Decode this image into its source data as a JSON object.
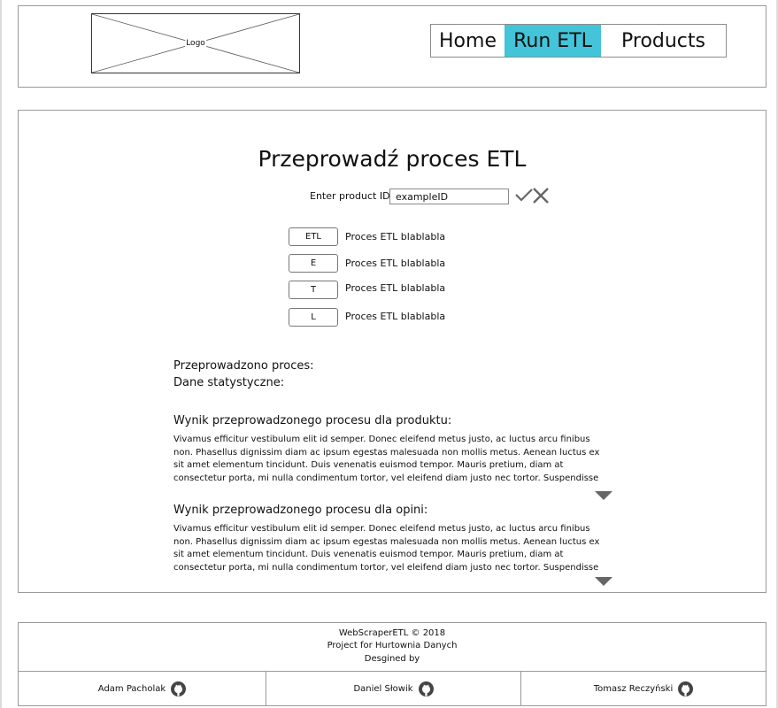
{
  "header": {
    "logo_text": "Logo",
    "nav": {
      "home": "Home",
      "run_etl": "Run ETL",
      "products": "Products"
    },
    "active_color": "#43c4d8"
  },
  "main": {
    "title": "Przeprowadź proces ETL",
    "product_id_label": "Enter product ID",
    "product_id_value": "exampleID",
    "steps": [
      {
        "button": "ETL",
        "description": "Proces ETL blablabla"
      },
      {
        "button": "E",
        "description": "Proces ETL blablabla"
      },
      {
        "button": "T",
        "description": "Proces ETL blablabla"
      },
      {
        "button": "L",
        "description": "Proces ETL blablabla"
      }
    ],
    "status_line": "Przeprowadzono proces:",
    "stats_line": "Dane statystyczne:",
    "product_result": {
      "title": "Wynik przeprowadzonego procesu dla produktu:",
      "text": "Vivamus efficitur vestibulum elit id semper. Donec eleifend metus justo, ac luctus arcu finibus non. Phasellus dignissim diam ac ipsum egestas malesuada non mollis metus. Aenean luctus ex sit amet elementum tincidunt. Duis venenatis euismod tempor. Mauris pretium, diam at consectetur porta, mi nulla condimentum tortor, vel eleifend diam justo nec tortor. Suspendisse sed imperdiet eros."
    },
    "opinion_result": {
      "title": "Wynik przeprowadzonego procesu dla opini:",
      "text": "Vivamus efficitur vestibulum elit id semper. Donec eleifend metus justo, ac luctus arcu finibus non. Phasellus dignissim diam ac ipsum egestas malesuada non mollis metus. Aenean luctus ex sit amet elementum tincidunt. Duis venenatis euismod tempor. Mauris pretium, diam at consectetur porta, mi nulla condimentum tortor, vel eleifend diam justo nec tortor. Suspendisse sed imperdiet eros."
    }
  },
  "footer": {
    "copyright": "WebScraperETL © 2018",
    "project": "Project for Hurtownia Danych",
    "designed_by": "Desgined by",
    "authors": [
      "Adam Pacholak",
      "Daniel Słowik",
      "Tomasz Reczyński"
    ]
  }
}
